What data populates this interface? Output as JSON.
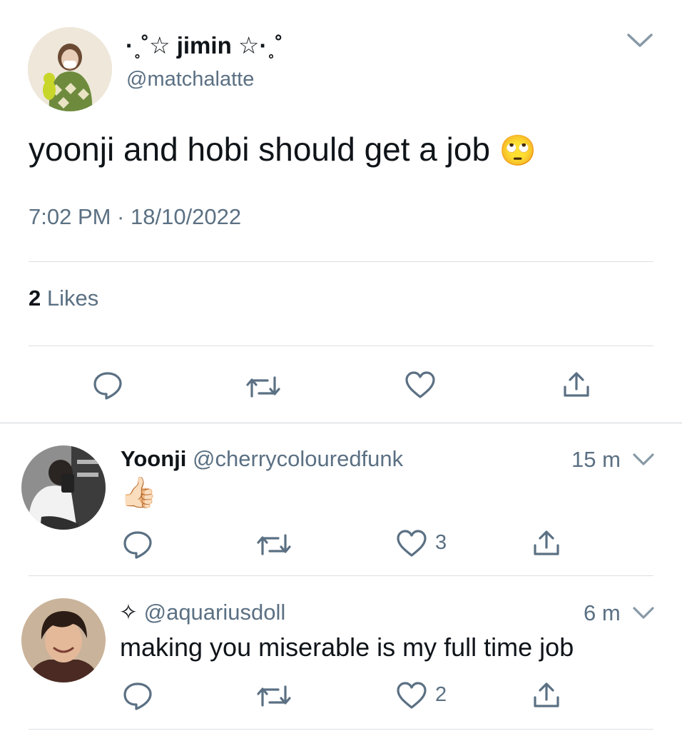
{
  "main_tweet": {
    "display_name": "·˳˚☆ jimin ☆·˳˚",
    "handle": "@matchalatte",
    "text": "yoonji and hobi should get a job",
    "emoji": "🙄",
    "timestamp": "7:02 PM · 18/10/2022",
    "likes_count": "2",
    "likes_label": "Likes",
    "actions": [
      "reply-icon",
      "retweet-icon",
      "like-icon",
      "share-icon"
    ]
  },
  "replies": [
    {
      "display_name": "Yoonji",
      "handle": "@cherrycolouredfunk",
      "time": "15 m",
      "text": "👍🏻",
      "like_count": "3"
    },
    {
      "name_icon": "✧",
      "handle": "@aquariusdoll",
      "time": "6 m",
      "text": "making you miserable is my full time job",
      "like_count": "2"
    }
  ],
  "colors": {
    "text": "#0f1419",
    "secondary": "#5b7083",
    "divider": "#dcdfe3"
  }
}
